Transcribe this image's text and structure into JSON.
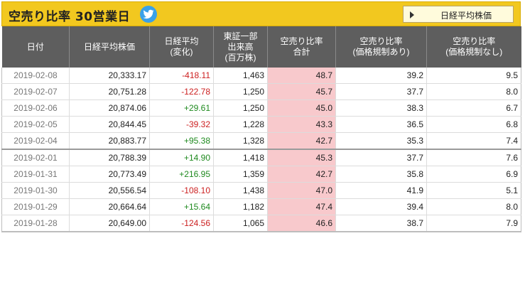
{
  "header": {
    "title": "空売り比率 30営業日",
    "button_label": "日経平均株価",
    "colors": {
      "bar": "#f2c81f",
      "twitter": "#3aa1e8",
      "table_head": "#5e5e5e",
      "negative": "#cc1f1f",
      "positive": "#1f8a1f",
      "ratio_bg": "#f8c9cc"
    }
  },
  "columns": [
    [
      "日付"
    ],
    [
      "日経平均株価"
    ],
    [
      "日経平均",
      "(変化)"
    ],
    [
      "東証一部",
      "出来高",
      "(百万株)"
    ],
    [
      "空売り比率",
      "合計"
    ],
    [
      "空売り比率",
      "(価格規制あり)"
    ],
    [
      "空売り比率",
      "(価格規制なし)"
    ]
  ],
  "rows": [
    {
      "date": "2019-02-08",
      "nikkei": "20,333.17",
      "change": "-418.11",
      "volume": "1,463",
      "total": "48.7",
      "restricted": "39.2",
      "unrestricted": "9.5"
    },
    {
      "date": "2019-02-07",
      "nikkei": "20,751.28",
      "change": "-122.78",
      "volume": "1,250",
      "total": "45.7",
      "restricted": "37.7",
      "unrestricted": "8.0"
    },
    {
      "date": "2019-02-06",
      "nikkei": "20,874.06",
      "change": "+29.61",
      "volume": "1,250",
      "total": "45.0",
      "restricted": "38.3",
      "unrestricted": "6.7"
    },
    {
      "date": "2019-02-05",
      "nikkei": "20,844.45",
      "change": "-39.32",
      "volume": "1,228",
      "total": "43.3",
      "restricted": "36.5",
      "unrestricted": "6.8"
    },
    {
      "date": "2019-02-04",
      "nikkei": "20,883.77",
      "change": "+95.38",
      "volume": "1,328",
      "total": "42.7",
      "restricted": "35.3",
      "unrestricted": "7.4"
    },
    {
      "date": "2019-02-01",
      "nikkei": "20,788.39",
      "change": "+14.90",
      "volume": "1,418",
      "total": "45.3",
      "restricted": "37.7",
      "unrestricted": "7.6"
    },
    {
      "date": "2019-01-31",
      "nikkei": "20,773.49",
      "change": "+216.95",
      "volume": "1,359",
      "total": "42.7",
      "restricted": "35.8",
      "unrestricted": "6.9"
    },
    {
      "date": "2019-01-30",
      "nikkei": "20,556.54",
      "change": "-108.10",
      "volume": "1,438",
      "total": "47.0",
      "restricted": "41.9",
      "unrestricted": "5.1"
    },
    {
      "date": "2019-01-29",
      "nikkei": "20,664.64",
      "change": "+15.64",
      "volume": "1,182",
      "total": "47.4",
      "restricted": "39.4",
      "unrestricted": "8.0"
    },
    {
      "date": "2019-01-28",
      "nikkei": "20,649.00",
      "change": "-124.56",
      "volume": "1,065",
      "total": "46.6",
      "restricted": "38.7",
      "unrestricted": "7.9"
    }
  ]
}
